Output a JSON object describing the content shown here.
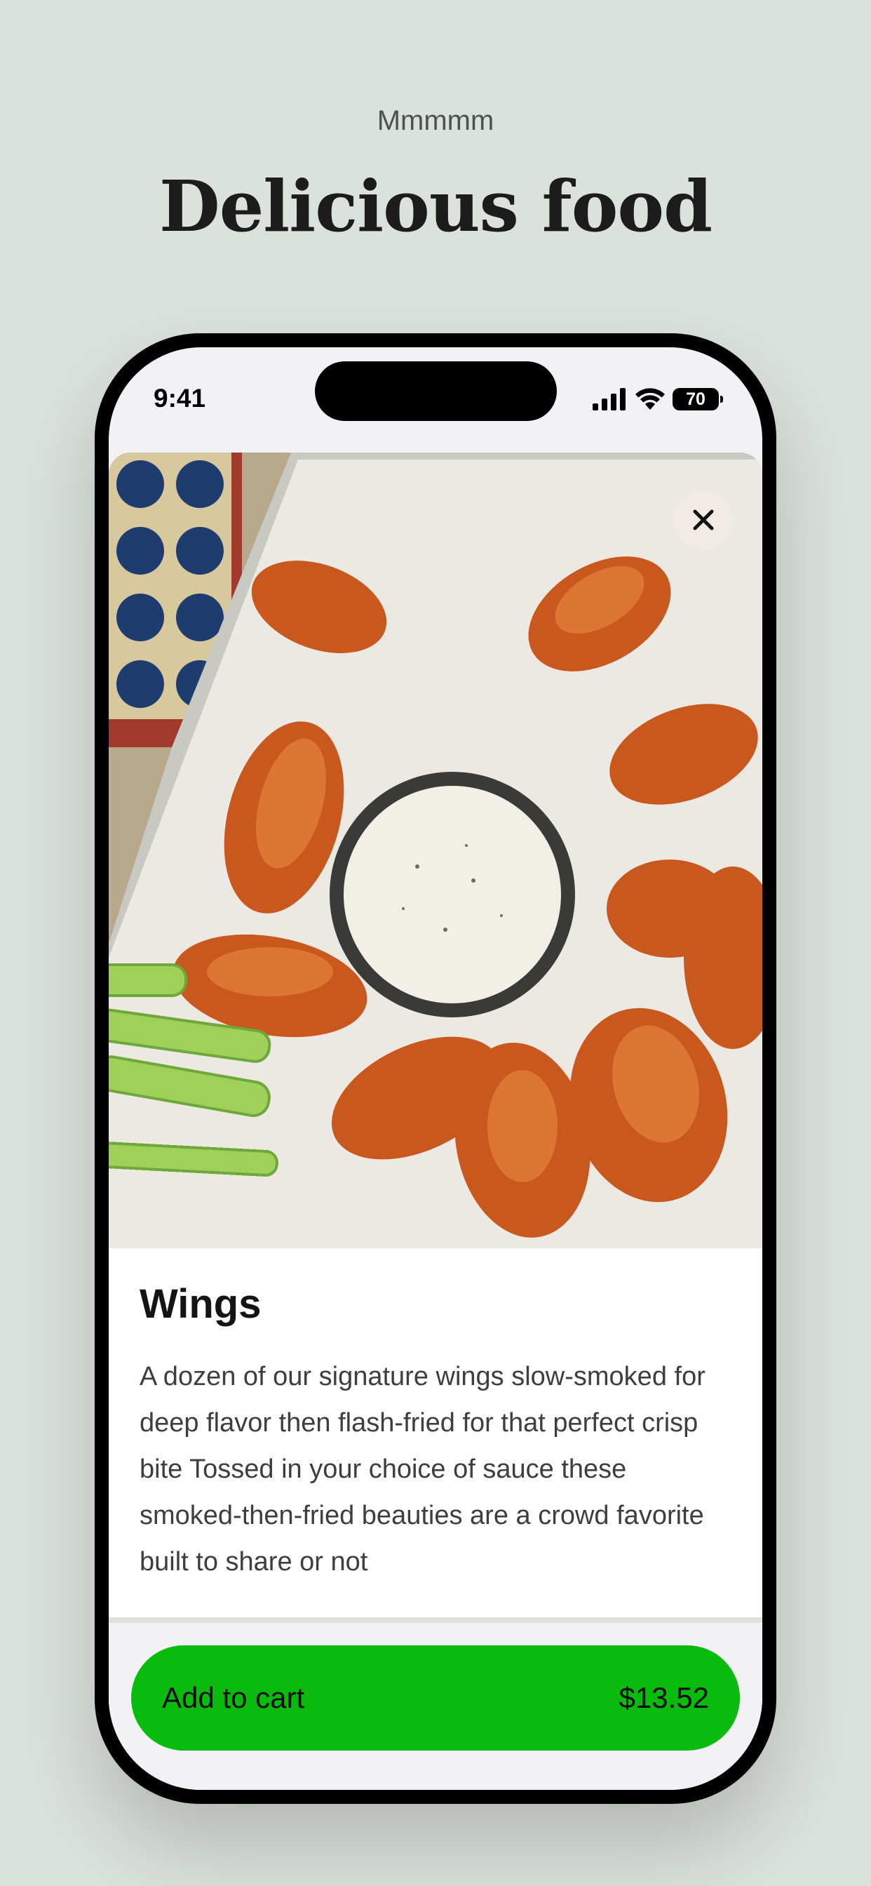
{
  "header": {
    "kicker": "Mmmmm",
    "headline": "Delicious food"
  },
  "status_bar": {
    "time": "9:41",
    "battery": "70"
  },
  "item": {
    "title": "Wings",
    "description": "A dozen of our signature wings slow-smoked for deep flavor then flash-fried for that perfect crisp bite Tossed in your choice of sauce these smoked-then-fried beauties are a crowd favorite built to share or not",
    "image_alt": "Plate of smoked wings with ranch dip and celery"
  },
  "cart": {
    "label": "Add to cart",
    "price": "$13.52"
  },
  "colors": {
    "page_background": "#dbe1db",
    "cart_button": "#09bb0c"
  },
  "icons": {
    "close": "close-icon",
    "signal": "cellular-signal-icon",
    "wifi": "wifi-icon",
    "battery": "battery-icon"
  }
}
